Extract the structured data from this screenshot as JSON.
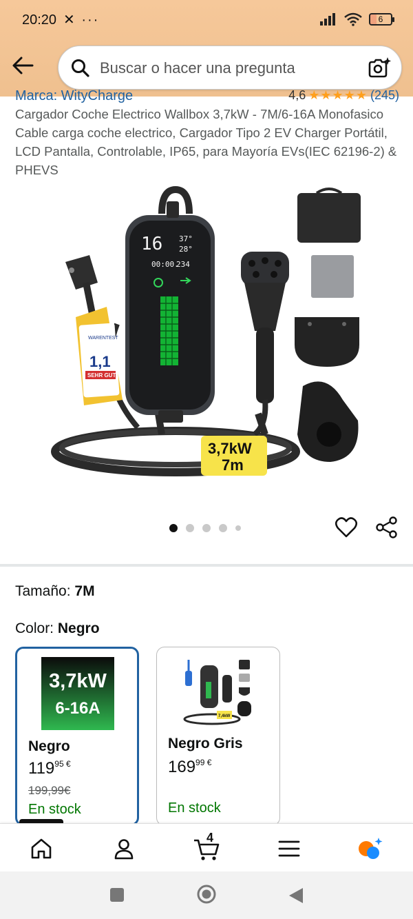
{
  "status": {
    "time": "20:20",
    "extra": "✕ ···",
    "battery": "6"
  },
  "search": {
    "placeholder": "Buscar o hacer una pregunta"
  },
  "product": {
    "brand": "Marca: WityCharge",
    "rating": "4,6",
    "rating_count": "(245)",
    "title": "Cargador Coche Electrico Wallbox 3,7kW - 7M/6-16A Monofasico Cable carga coche electrico, Cargador Tipo 2 EV Charger Portátil, LCD Pantalla, Controlable, IP65, para Mayoría EVs(IEC 62196-2) & PHEVS",
    "image_labels": {
      "power": "3,7kW",
      "length": "7m",
      "lcd_digits": "16",
      "lcd_temp1": "37°",
      "lcd_temp2": "28°",
      "lcd_time": "00:00.",
      "lcd_volt": "234",
      "tag_brand": "WARENTEST",
      "tag_grade": "1,1",
      "tag_label": "SEHR GUT"
    }
  },
  "carousel": {
    "count": 5,
    "active": 0
  },
  "options": {
    "size_label": "Tamaño:",
    "size_value": "7M",
    "color_label": "Color:",
    "color_value": "Negro"
  },
  "variants": [
    {
      "name": "Negro",
      "price_whole": "119",
      "price_cents": "95 €",
      "was_price": "199,99€",
      "stock": "En stock",
      "thumb_line1": "3,7kW",
      "thumb_line2": "6-16A"
    },
    {
      "name": "Negro Gris",
      "price_whole": "169",
      "price_cents": "99 €",
      "stock": "En stock",
      "thumb_label": "7,4kW"
    }
  ],
  "nav": {
    "cart_count": "4"
  },
  "colors": {
    "header": "#f6c89a",
    "link": "#2162a1",
    "stock": "#007600",
    "star": "#ff9f1c",
    "selected_border": "#2162a1"
  }
}
